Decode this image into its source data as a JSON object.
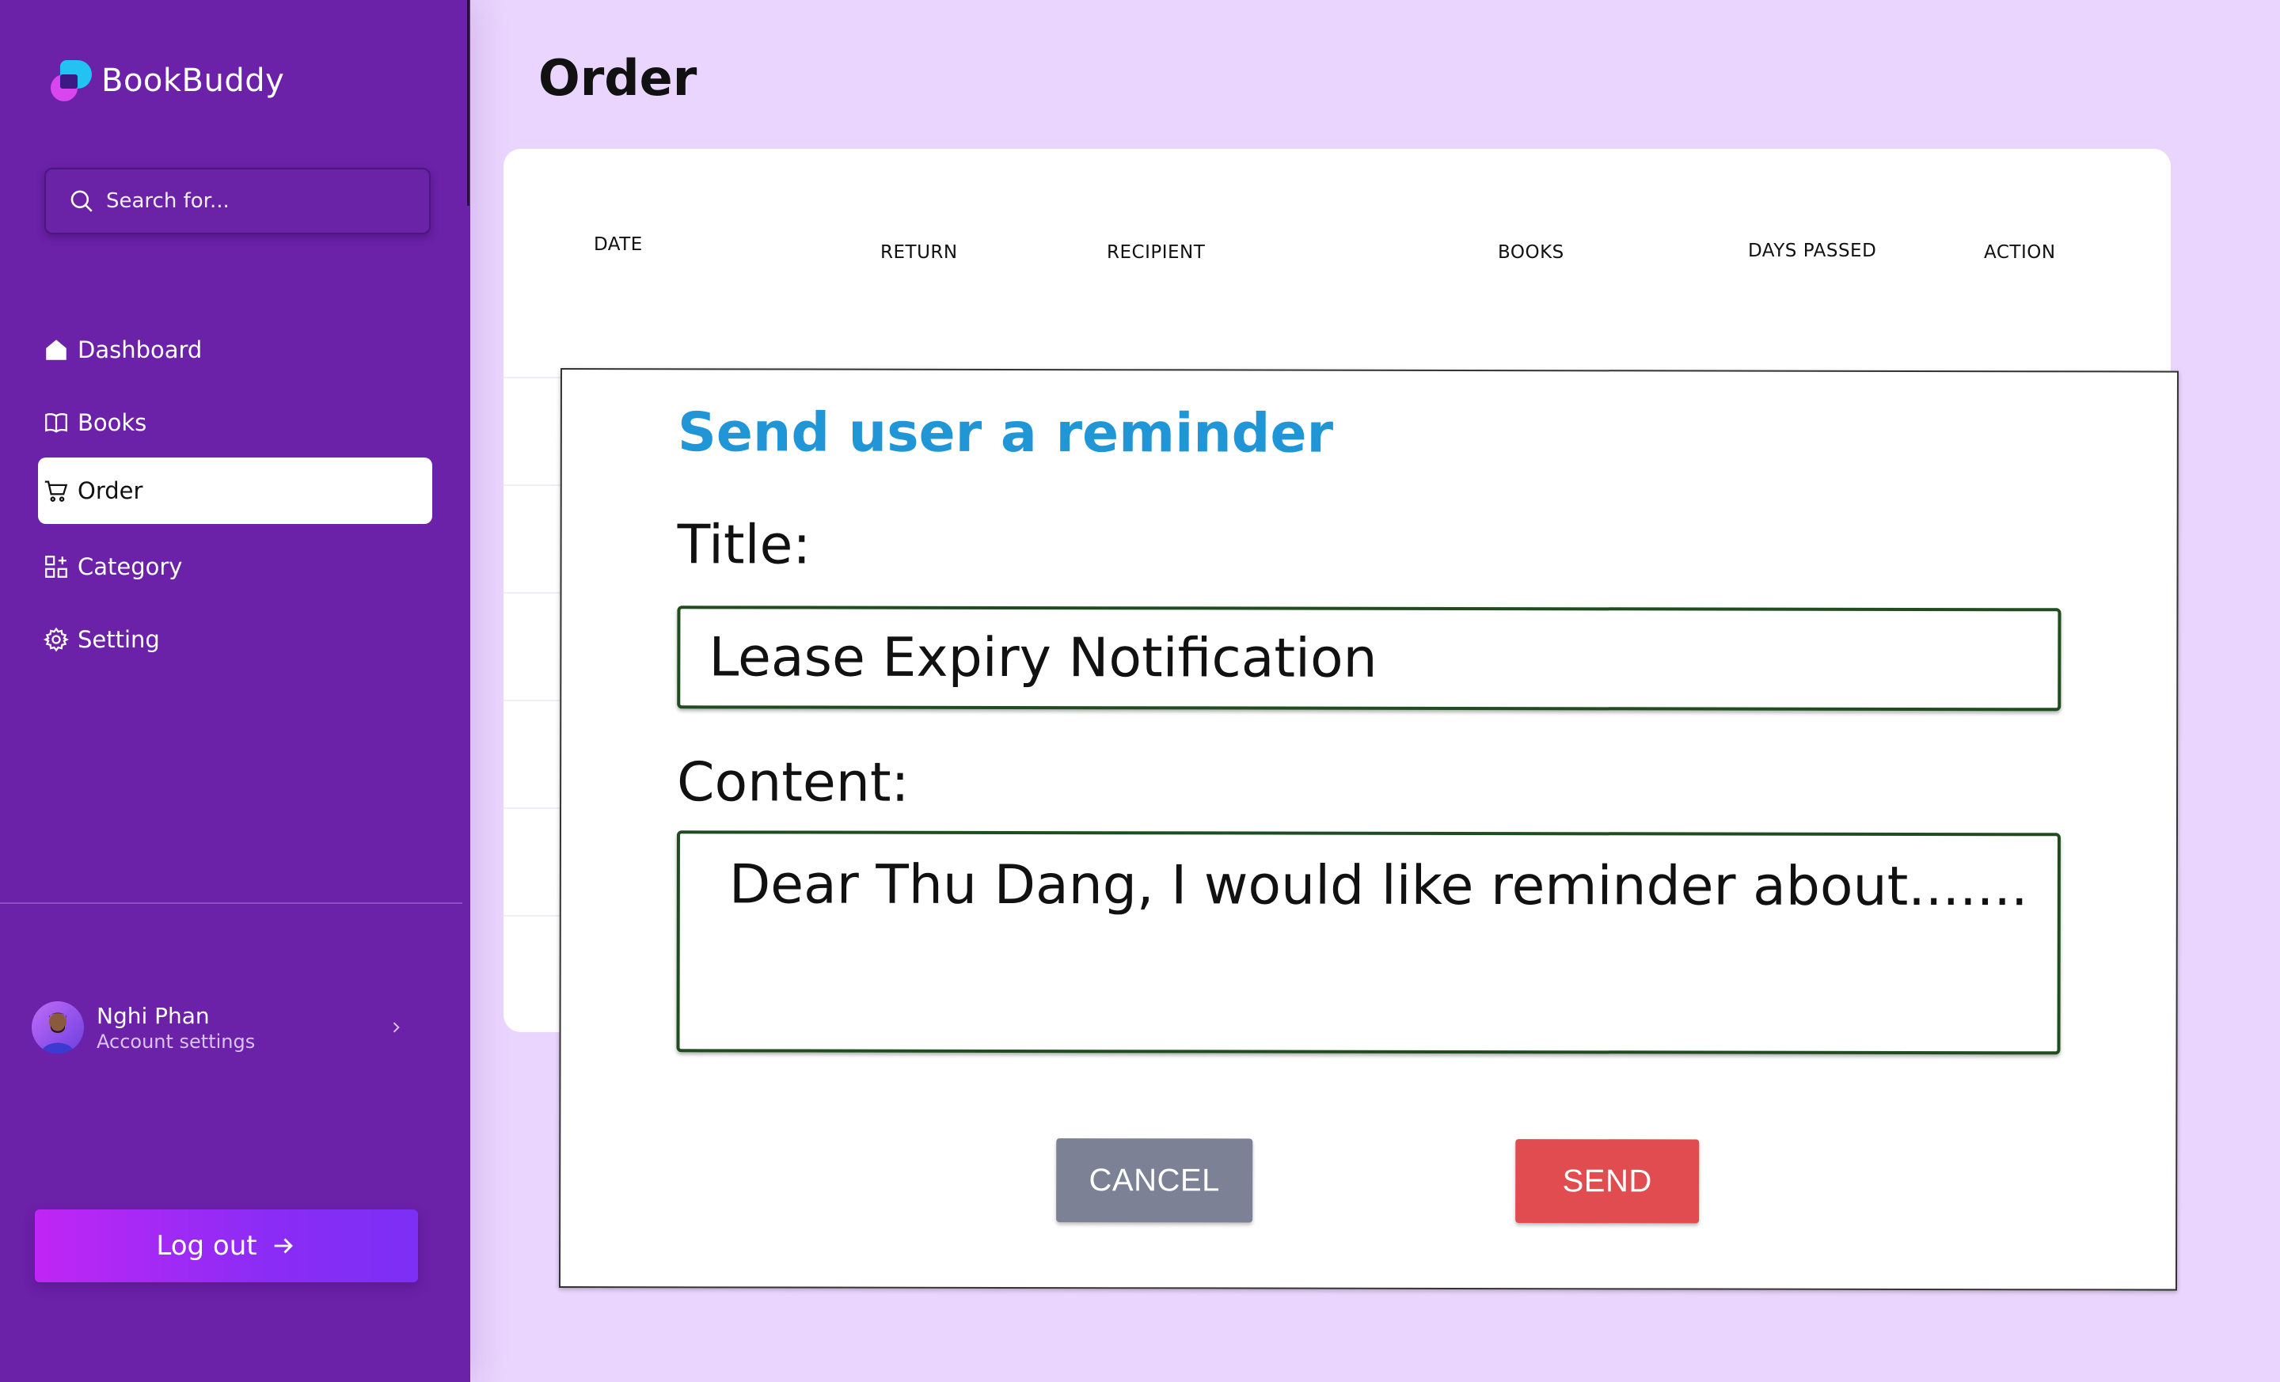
{
  "app": {
    "name": "BookBuddy"
  },
  "search": {
    "placeholder": "Search for..."
  },
  "nav": [
    {
      "label": "Dashboard",
      "icon": "home-icon"
    },
    {
      "label": "Books",
      "icon": "book-icon"
    },
    {
      "label": "Order",
      "icon": "cart-icon",
      "active": true
    },
    {
      "label": "Category",
      "icon": "category-icon"
    },
    {
      "label": "Setting",
      "icon": "gear-icon"
    }
  ],
  "account": {
    "name": "Nghi Phan",
    "subtitle": "Account settings"
  },
  "logout": {
    "label": "Log out"
  },
  "page": {
    "title": "Order"
  },
  "table": {
    "columns": [
      "DATE",
      "RETURN",
      "RECIPIENT",
      "BOOKS",
      "DAYS PASSED",
      "ACTION"
    ]
  },
  "modal": {
    "title": "Send user a reminder",
    "title_label": "Title:",
    "title_value": "Lease Expiry Notification",
    "content_label": "Content:",
    "content_value": "Dear Thu Dang, I would like reminder about.......",
    "cancel_label": "CANCEL",
    "send_label": "SEND"
  },
  "colors": {
    "sidebar": "#6b21a8",
    "background": "#e9d5fd",
    "modal_title": "#2196d6",
    "cancel": "#7c8196",
    "send": "#e04c4f",
    "field_border": "#1f4d1f"
  }
}
